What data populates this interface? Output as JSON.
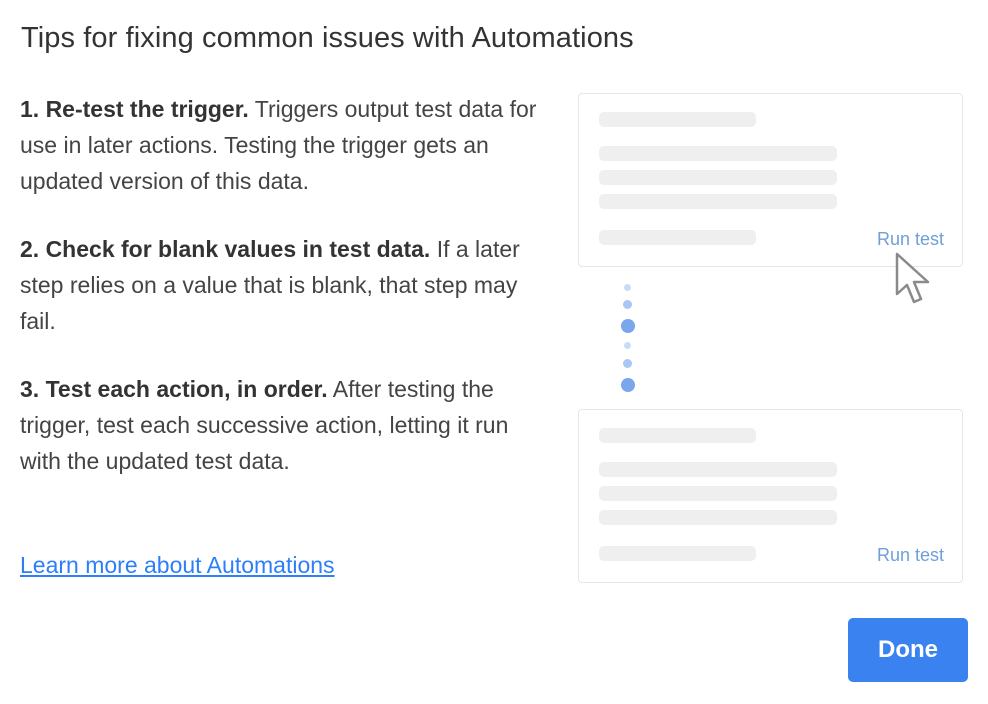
{
  "dialog": {
    "title": "Tips for fixing common issues with Automations",
    "tips": [
      {
        "title": "1. Re-test the trigger.",
        "body": " Triggers output test data for use in later actions. Testing the trigger gets an updated version of this data."
      },
      {
        "title": "2. Check for blank values in test data.",
        "body": " If a later step relies on a value that is blank, that step may fail."
      },
      {
        "title": "3. Test each action, in order.",
        "body": " After testing the trigger, test each successive action, letting it run with the updated test data."
      }
    ],
    "learn_more_link": "Learn more about Automations",
    "done_button": "Done"
  },
  "illustration": {
    "top_card": {
      "run_test_label": "Run test"
    },
    "bottom_card": {
      "run_test_label": "Run test"
    },
    "cursor_icon": "pointer-cursor-icon"
  },
  "colors": {
    "accent": "#3a82f0",
    "link": "#2d7ff9",
    "run_test_text": "#6f9fd8",
    "connector_dot": "#7aa6ec"
  }
}
